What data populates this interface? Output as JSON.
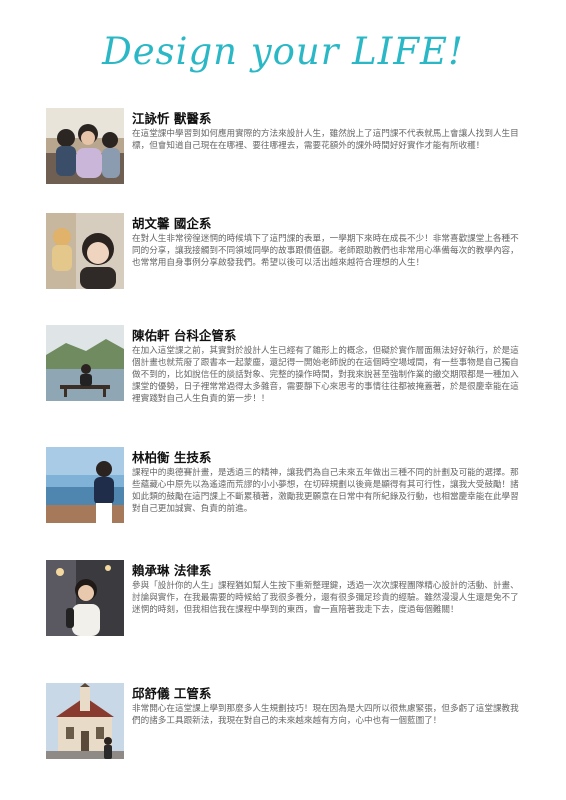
{
  "page_title": "Design your LIFE!",
  "entries": [
    {
      "name": "江詠忻 獸醫系",
      "text": "在這堂課中學習到如何應用實際的方法來設計人生，雖然說上了這門課不代表就馬上會讓人找到人生目標，但會知道自己現在在哪裡、要往哪裡去，需要花額外的課外時間好好實作才能有所收穫！"
    },
    {
      "name": "胡文馨 國企系",
      "text": "在對人生非常徬徨迷惘的時候填下了這門課的表單，一學期下來時在成長不少！非常喜歡課堂上各種不同的分享，讓我接觸到不同領域同學的故事跟價值觀。老師跟助教們也非常用心準備每次的教學內容，也常常用自身事例分享啟發我們。希望以後可以活出越來越符合理想的人生！"
    },
    {
      "name": "陳佑軒 台科企管系",
      "text": "在加入這堂課之前，其實對於設計人生已經有了雛形上的概念，但礙於實作層面無法好好執行，於是這個計畫也就荒廢了跟書本一起蒙塵，還記得一開始老師說的在這個時空場域間，有一些事物是自己獨自做不到的，比如說信任的談話對象、完整的操作時間，對我來說甚至強制作業的繳交期限都是一種加入課堂的優勢，日子裡常常過得太多雜音，需要靜下心來思考的事情往往都被掩蓋著，於是很慶幸能在這裡實踐對自己人生負責的第一步！！"
    },
    {
      "name": "林柏衡 生技系",
      "text": "課程中的奧德賽計畫，是透過三的精神，讓我們為自己未來五年做出三種不同的計劃及可能的選擇。那些蘊藏心中原先以為遙遠而荒謬的小小夢想，在切碎規劃以後竟是顯得有其可行性，讓我大受鼓勵！諸如此類的鼓勵在這門課上不斷累積著，激勵我更願意在日常中有所紀錄及行動，也相當慶幸能在此學習對自己更加誠實、負責的前進。"
    },
    {
      "name": "賴承琳 法律系",
      "text": "參與「設計你的人生」課程猶如幫人生按下重新整理鍵，透過一次次課程團隊精心設計的活動、計畫、討論與實作，在我最需要的時候給了我很多養分，還有很多彌足珍貴的經驗。雖然漫漫人生還是免不了迷惘的時刻，但我相信我在課程中學到的東西，會一直陪著我走下去，度過每個難關！"
    },
    {
      "name": "邱舒儀 工管系",
      "text": "非常開心在這堂課上學到那麼多人生規劃技巧！現在因為是大四所以很焦慮緊張，但多虧了這堂課教我們的諸多工具跟新法，我現在對自己的未來越來越有方向，心中也有一個藍圖了！"
    }
  ]
}
